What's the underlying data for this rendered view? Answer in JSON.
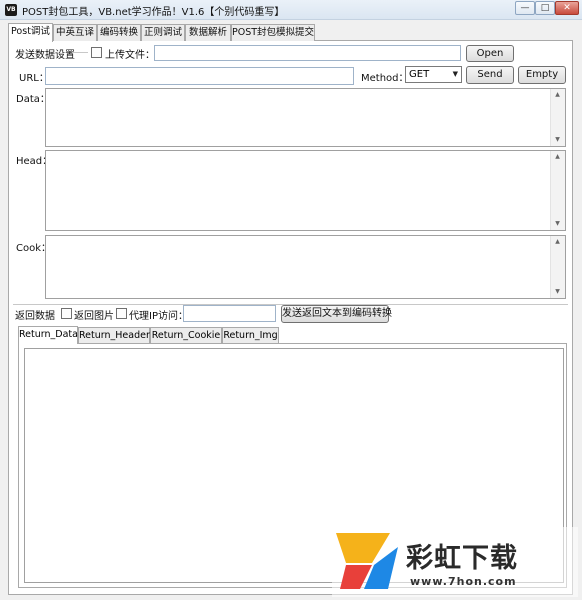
{
  "window": {
    "title": "POST封包工具，VB.net学习作品！V1.6【个别代码重写】",
    "minimize": "—",
    "maximize": "□",
    "close": "✕"
  },
  "main_tabs": [
    {
      "label": "Post调试",
      "active": true
    },
    {
      "label": "中英互译"
    },
    {
      "label": "编码转换"
    },
    {
      "label": "正则调试"
    },
    {
      "label": "数据解析"
    },
    {
      "label": "POST封包模拟提交"
    }
  ],
  "send_section": {
    "title": "发送数据设置",
    "upload_label": "上传文件：",
    "upload_value": "",
    "open_button": "Open",
    "url_label": "URL：",
    "url_value": "",
    "method_label": "Method：",
    "method_selected": "GET",
    "send_button": "Send",
    "empty_button": "Empty",
    "data_label": "Data：",
    "head_label": "Head：",
    "cook_label": "Cook："
  },
  "return_section": {
    "title": "返回数据",
    "return_image_label": "返回图片",
    "proxy_label": "代理IP访问：",
    "proxy_value": "",
    "send_to_encoder_button": "发送返回文本到编码转换",
    "tabs": [
      {
        "label": "Return_Data",
        "active": true
      },
      {
        "label": "Return_Header"
      },
      {
        "label": "Return_Cookie"
      },
      {
        "label": "Return_Img"
      }
    ]
  },
  "watermark": {
    "brand": "彩虹下载",
    "url": "www.7hon.com",
    "colors": [
      "#f5b21a",
      "#e8403a",
      "#1e88e5"
    ]
  }
}
